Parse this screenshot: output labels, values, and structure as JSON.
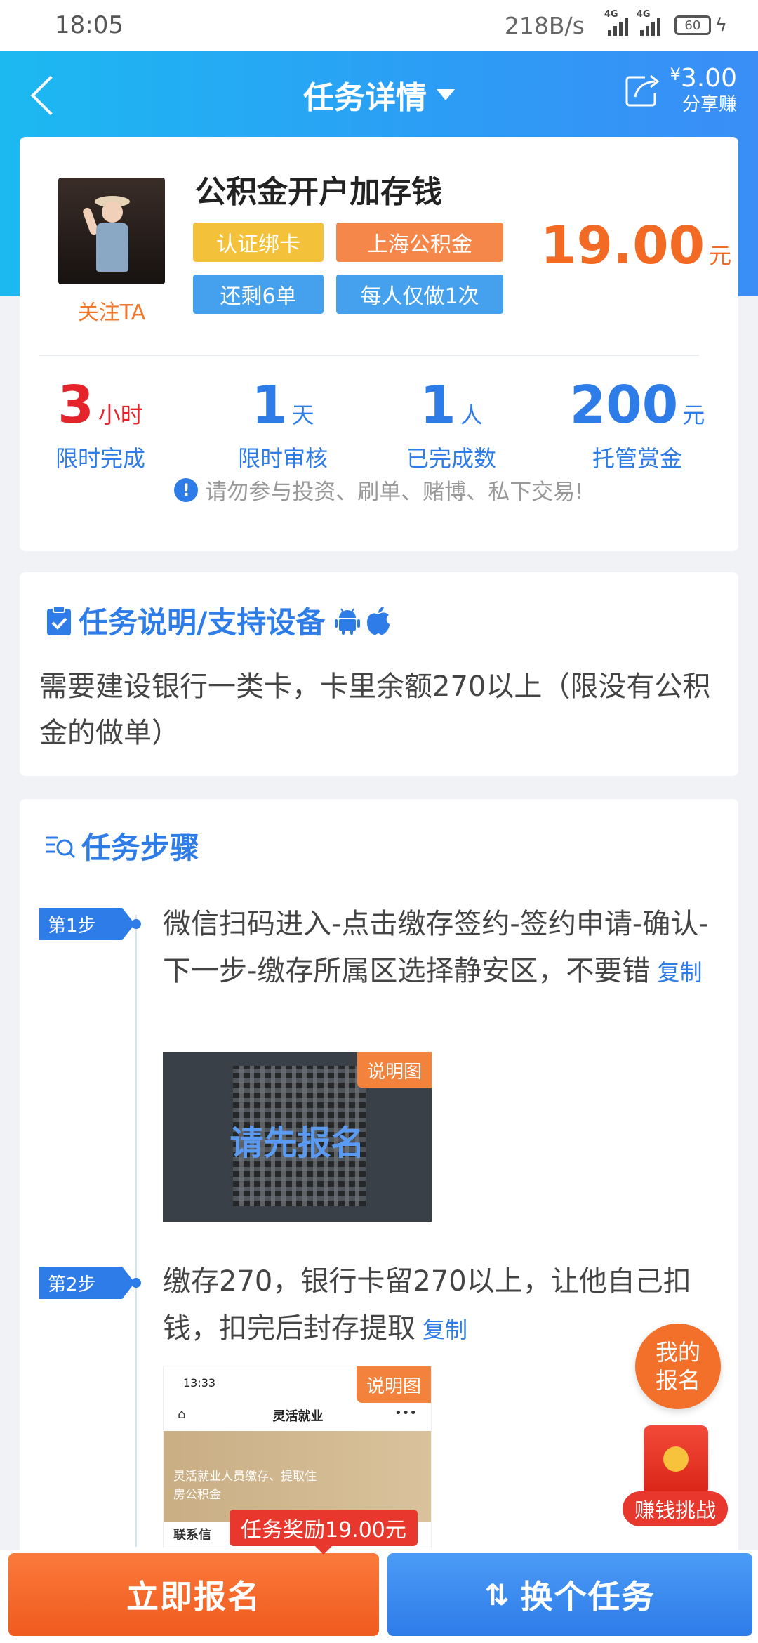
{
  "status_bar": {
    "time": "18:05",
    "speed": "218B/s",
    "signal1": "4G",
    "signal2": "4G",
    "battery": "60"
  },
  "nav": {
    "title": "任务详情",
    "share_currency": "¥",
    "share_amount": "3.00",
    "share_label": "分享赚"
  },
  "task": {
    "title": "公积金开户加存钱",
    "follow": "关注TA",
    "tags": [
      "认证绑卡",
      "上海公积金",
      "还剩6单",
      "每人仅做1次"
    ],
    "price": "19.00",
    "price_unit": "元",
    "stats": [
      {
        "num": "3",
        "unit": "小时",
        "label": "限时完成"
      },
      {
        "num": "1",
        "unit": "天",
        "label": "限时审核"
      },
      {
        "num": "1",
        "unit": "人",
        "label": "已完成数"
      },
      {
        "num": "200",
        "unit": "元",
        "label": "托管赏金"
      }
    ],
    "warning": "请勿参与投资、刷单、赌博、私下交易!"
  },
  "description": {
    "title": "任务说明/支持设备",
    "text": "需要建设银行一类卡，卡里余额270以上（限没有公积金的做单）"
  },
  "steps_section": {
    "title": "任务步骤",
    "steps": [
      {
        "badge": "第1步",
        "text": "微信扫码进入-点击缴存签约-签约申请-确认-下一步-缴存所属区选择静安区，不要错",
        "copy": "复制",
        "image_tag": "说明图",
        "image_cover": "请先报名"
      },
      {
        "badge": "第2步",
        "text": "缴存270，银行卡留270以上，让他自己扣钱，扣完后封存提取",
        "copy": "复制",
        "image_tag": "说明图"
      }
    ],
    "mini_screen": {
      "time": "13:33",
      "title": "灵活就业",
      "dots": "•••",
      "banner_text": "灵活就业人员缴存、提取住房公积金",
      "contact": "联系信"
    }
  },
  "floating": {
    "my_apply": [
      "我的",
      "报名"
    ],
    "earn": "赚钱挑战"
  },
  "reward_tip": "任务奖励19.00元",
  "buttons": {
    "apply": "立即报名",
    "switch": "换个任务"
  },
  "colors": {
    "primary": "#2e7ce8",
    "accent": "#f26a23",
    "danger": "#e4232b"
  }
}
